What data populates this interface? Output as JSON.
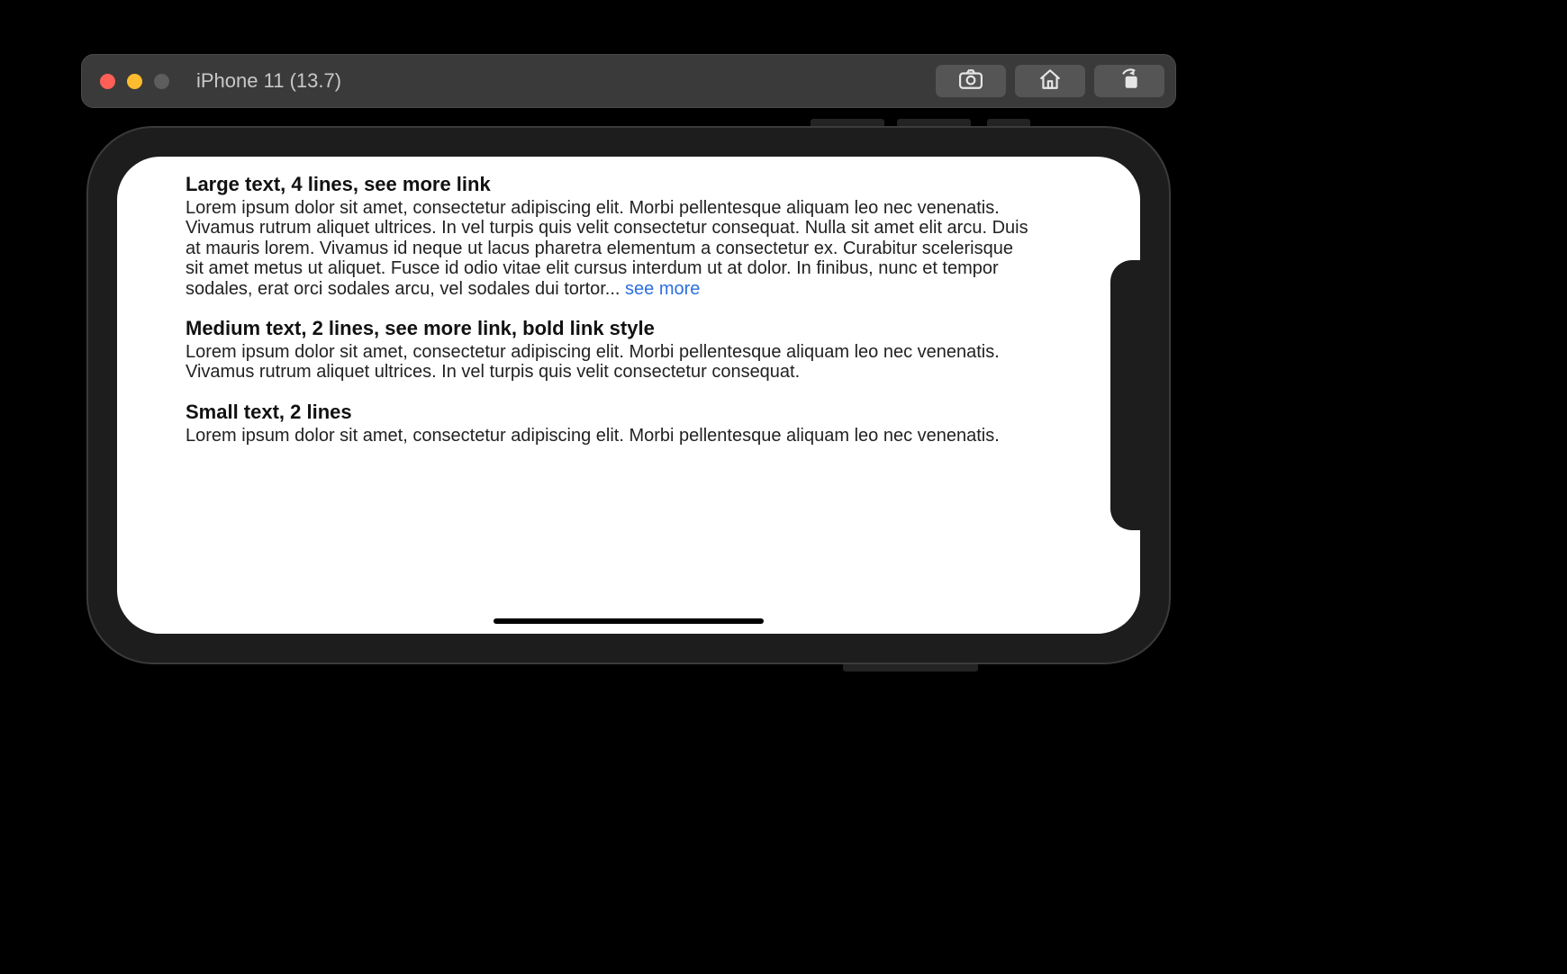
{
  "window": {
    "title": "iPhone 11 (13.7)"
  },
  "sections": [
    {
      "title": "Large text, 4 lines, see more link",
      "body": "Lorem ipsum dolor sit amet, consectetur adipiscing elit. Morbi pellentesque aliquam leo nec venenatis. Vivamus rutrum aliquet ultrices. In vel turpis quis velit consectetur consequat. Nulla sit amet elit arcu. Duis at mauris lorem. Vivamus id neque ut lacus pharetra elementum a consectetur ex. Curabitur scelerisque sit amet metus ut aliquet. Fusce id odio vitae elit cursus interdum ut at dolor. In finibus, nunc et tempor sodales, erat orci sodales arcu, vel sodales dui tortor... ",
      "see_more": "see more"
    },
    {
      "title": "Medium text, 2 lines, see more link, bold link style",
      "body": "Lorem ipsum dolor sit amet, consectetur adipiscing elit. Morbi pellentesque aliquam leo nec venenatis. Vivamus rutrum aliquet ultrices. In vel turpis quis velit consectetur consequat."
    },
    {
      "title": "Small text, 2 lines",
      "body": "Lorem ipsum dolor sit amet, consectetur adipiscing elit. Morbi pellentesque aliquam leo nec venenatis."
    }
  ]
}
